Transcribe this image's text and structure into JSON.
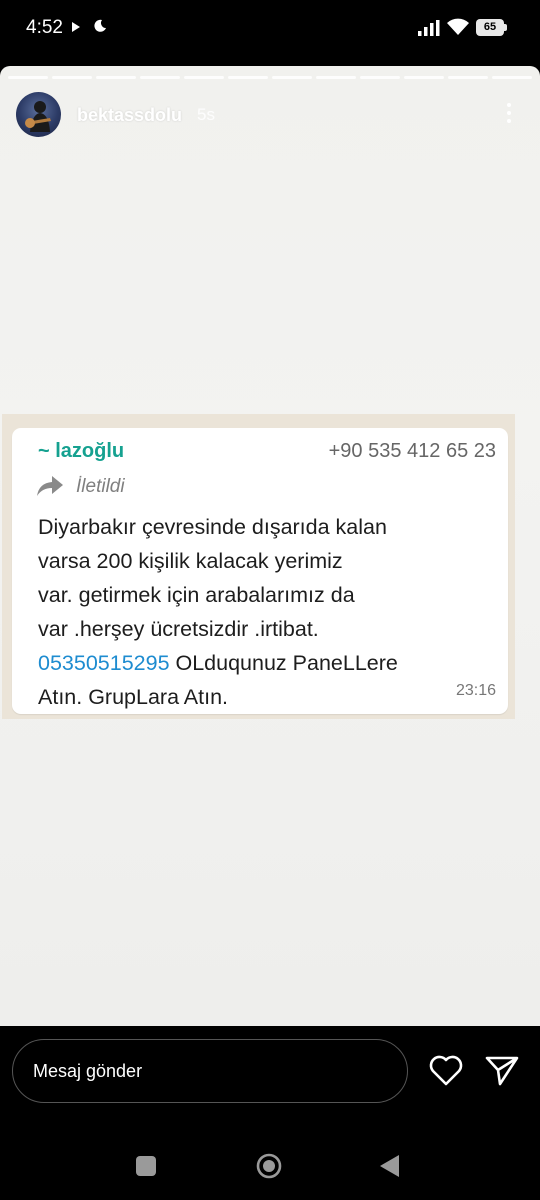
{
  "status_bar": {
    "time": "4:52",
    "battery": "65",
    "icons": [
      "play-icon",
      "moon-icon",
      "signal-icon",
      "wifi-icon",
      "battery-icon"
    ]
  },
  "story": {
    "username": "bektassdolu",
    "age": "5s",
    "segments": 12
  },
  "message": {
    "sender": "~ lazoğlu",
    "sender_phone": "+90 535 412 65 23",
    "forwarded_label": "İletildi",
    "lines": [
      "Diyarbakır çevresinde dışarıda kalan",
      "varsa 200 kişilik kalacak yerimiz",
      "var. getirmek için arabalarımız da",
      "var  .herşey ücretsizdir .irtibat."
    ],
    "phone_link": "05350515295",
    "line5_rest": " OLduqunuz PaneLLere",
    "line6": "Atın. GrupLara Atın.",
    "time": "23:16",
    "colors": {
      "sender": "#15a190",
      "link": "#1e8cd0",
      "bubble": "#ffffff"
    }
  },
  "reply": {
    "placeholder": "Mesaj gönder",
    "icons": [
      "heart-icon",
      "send-icon"
    ]
  },
  "nav": {
    "icons": [
      "recent-apps-icon",
      "home-icon",
      "back-icon"
    ]
  }
}
